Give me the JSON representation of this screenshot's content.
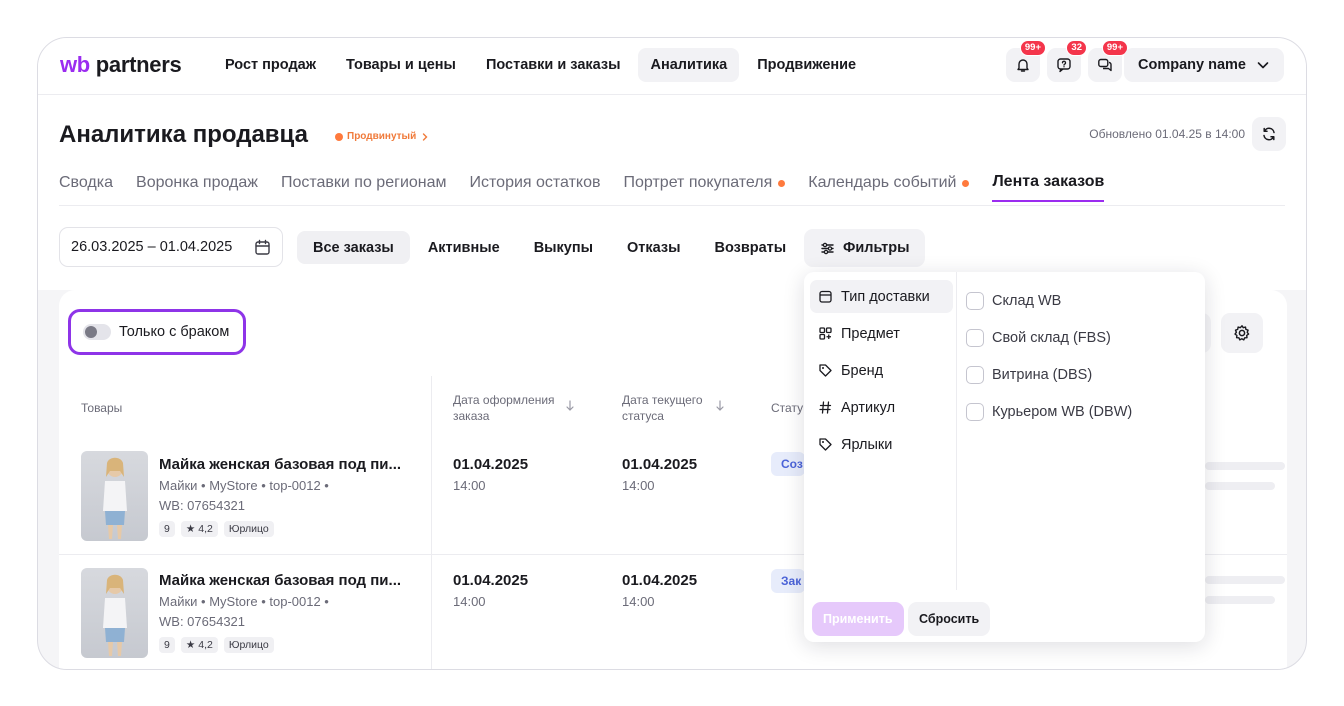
{
  "brand": {
    "logo_wb": "wb",
    "logo_rest": " partners"
  },
  "nav": {
    "items": [
      {
        "label": "Рост продаж",
        "active": false
      },
      {
        "label": "Товары и цены",
        "active": false
      },
      {
        "label": "Поставки и заказы",
        "active": false
      },
      {
        "label": "Аналитика",
        "active": true
      },
      {
        "label": "Продвижение",
        "active": false
      }
    ]
  },
  "header_icons": {
    "bell_badge": "99+",
    "support_badge": "32",
    "chat_badge": "99+"
  },
  "account": {
    "company": "Company name"
  },
  "page": {
    "title": "Аналитика продавца",
    "plan": "Продвинутый",
    "updated": "Обновлено 01.04.25 в 14:00"
  },
  "tabs": [
    {
      "label": "Сводка"
    },
    {
      "label": "Воронка продаж"
    },
    {
      "label": "Поставки по регионам"
    },
    {
      "label": "История остатков"
    },
    {
      "label": "Портрет покупателя"
    },
    {
      "label": "Календарь событий"
    },
    {
      "label": "Лента заказов"
    }
  ],
  "filters": {
    "date_range": "26.03.2025 – 01.04.2025",
    "segments": [
      "Все заказы",
      "Активные",
      "Выкупы",
      "Отказы",
      "Возвраты"
    ],
    "filters_label": "Фильтры"
  },
  "defect_toggle": {
    "label": "Только с браком",
    "on": false
  },
  "table": {
    "headers": {
      "products": "Товары",
      "order_date_1": "Дата оформления",
      "order_date_2": "заказа",
      "status_date_1": "Дата текущего",
      "status_date_2": "статуса",
      "status": "Стату"
    },
    "rows": [
      {
        "name": "Майка женская базовая под пи...",
        "meta": "Майки • MyStore • top-0012 •",
        "wb": "WB: 07654321",
        "chip_count": "9",
        "rating": "4,2",
        "chip_type": "Юрлицо",
        "order_date": "01.04.2025",
        "order_time": "14:00",
        "status_date": "01.04.2025",
        "status_time": "14:00",
        "status": "Соз"
      },
      {
        "name": "Майка женская базовая под пи...",
        "meta": "Майки • MyStore • top-0012 •",
        "wb": "WB: 07654321",
        "chip_count": "9",
        "rating": "4,2",
        "chip_type": "Юрлицо",
        "order_date": "01.04.2025",
        "order_time": "14:00",
        "status_date": "01.04.2025",
        "status_time": "14:00",
        "status": "Зак"
      }
    ]
  },
  "dropdown": {
    "categories": [
      {
        "label": "Тип доставки",
        "icon": "calendar-box-icon",
        "active": true
      },
      {
        "label": "Предмет",
        "icon": "grid-icon",
        "active": false
      },
      {
        "label": "Бренд",
        "icon": "tag-icon",
        "active": false
      },
      {
        "label": "Артикул",
        "icon": "hash-icon",
        "active": false
      },
      {
        "label": "Ярлыки",
        "icon": "tag-icon",
        "active": false
      }
    ],
    "options": [
      {
        "label": "Склад WB",
        "checked": false
      },
      {
        "label": "Свой склад (FBS)",
        "checked": false
      },
      {
        "label": "Витрина (DBS)",
        "checked": false
      },
      {
        "label": "Курьером WB (DBW)",
        "checked": false
      }
    ],
    "apply_label": "Применить",
    "reset_label": "Сбросить"
  },
  "colors": {
    "accent": "#9b2cf0",
    "highlight_border": "#8e34e8",
    "badge": "#f4354b",
    "plan": "#ff7a3d",
    "status_bg": "#e7ecfb",
    "status_text": "#4b63d8"
  }
}
